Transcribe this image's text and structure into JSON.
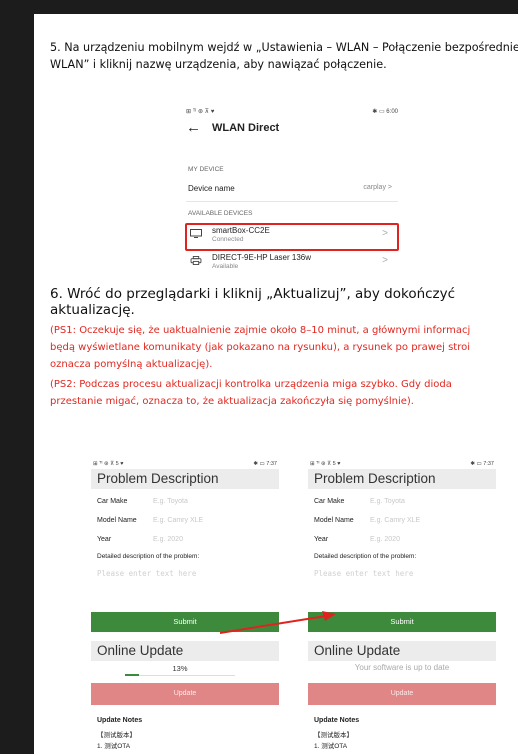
{
  "step5": {
    "text": "5. Na urządzeniu mobilnym wejdź w „Ustawienia – WLAN – Połączenie bezpośrednie WLAN” i kliknij nazwę urządzenia, aby nawiązać połączenie."
  },
  "wlan": {
    "status_left": "⊞ ᵀᴵ ⊛ ⊼ ♥",
    "status_right": "✱ ▭ 6:00",
    "back_icon": "←",
    "title": "WLAN Direct",
    "my_device_label": "MY DEVICE",
    "device_name_label": "Device name",
    "device_name_value": "carplay",
    "available_label": "AVAILABLE DEVICES",
    "devices": [
      {
        "name": "smartBox-CC2E",
        "status": "Connected",
        "icon": "monitor-icon"
      },
      {
        "name": "DIRECT-9E-HP Laser 136w",
        "status": "Available",
        "icon": "printer-icon"
      }
    ],
    "highlight_color": "#e0231f"
  },
  "step6": {
    "text": "6. Wróć do przeglądarki i kliknij „Aktualizuj”, aby dokończyć aktualizację."
  },
  "ps1": {
    "lines": [
      "(PS1: Oczekuje się, że uaktualnienie zajmie około 8–10 minut, a głównymi informacj",
      "będą wyświetlane komunikaty (jak pokazano na rysunku), a rysunek po prawej stroi",
      "oznacza pomyślną aktualizację)."
    ]
  },
  "ps2": {
    "lines": [
      "(PS2: Podczas procesu aktualizacji kontrolka urządzenia miga szybko. Gdy dioda",
      "przestanie migać, oznacza to, że aktualizacja zakończyła się pomyślnie)."
    ]
  },
  "form": {
    "status_left": "⊞ ᵀᴵ ⊛ ⊼ 5 ♥",
    "status_right": "✱ ▭ 7:37",
    "header": "Problem Description",
    "car_make_label": "Car Make",
    "car_make_placeholder": "E.g. Toyota",
    "model_label": "Model Name",
    "model_placeholder": "E.g. Camry XLE",
    "year_label": "Year",
    "year_placeholder": "E.g. 2020",
    "desc_label": "Detailed description of the problem:",
    "textarea_placeholder": "Please enter text here",
    "submit": "Submit",
    "online_update": "Online Update",
    "update_button": "Update",
    "notes_title": "Update Notes",
    "notes_line1": "【测试版本】",
    "notes_line2": "1. 测试OTA"
  },
  "left_progress": {
    "percent_text": "13%",
    "value": 0.13
  },
  "right_status": "Your software is up to date",
  "colors": {
    "accent_green": "#3d8a3d",
    "update_pink": "#e18686",
    "warning_red": "#e1271f"
  }
}
